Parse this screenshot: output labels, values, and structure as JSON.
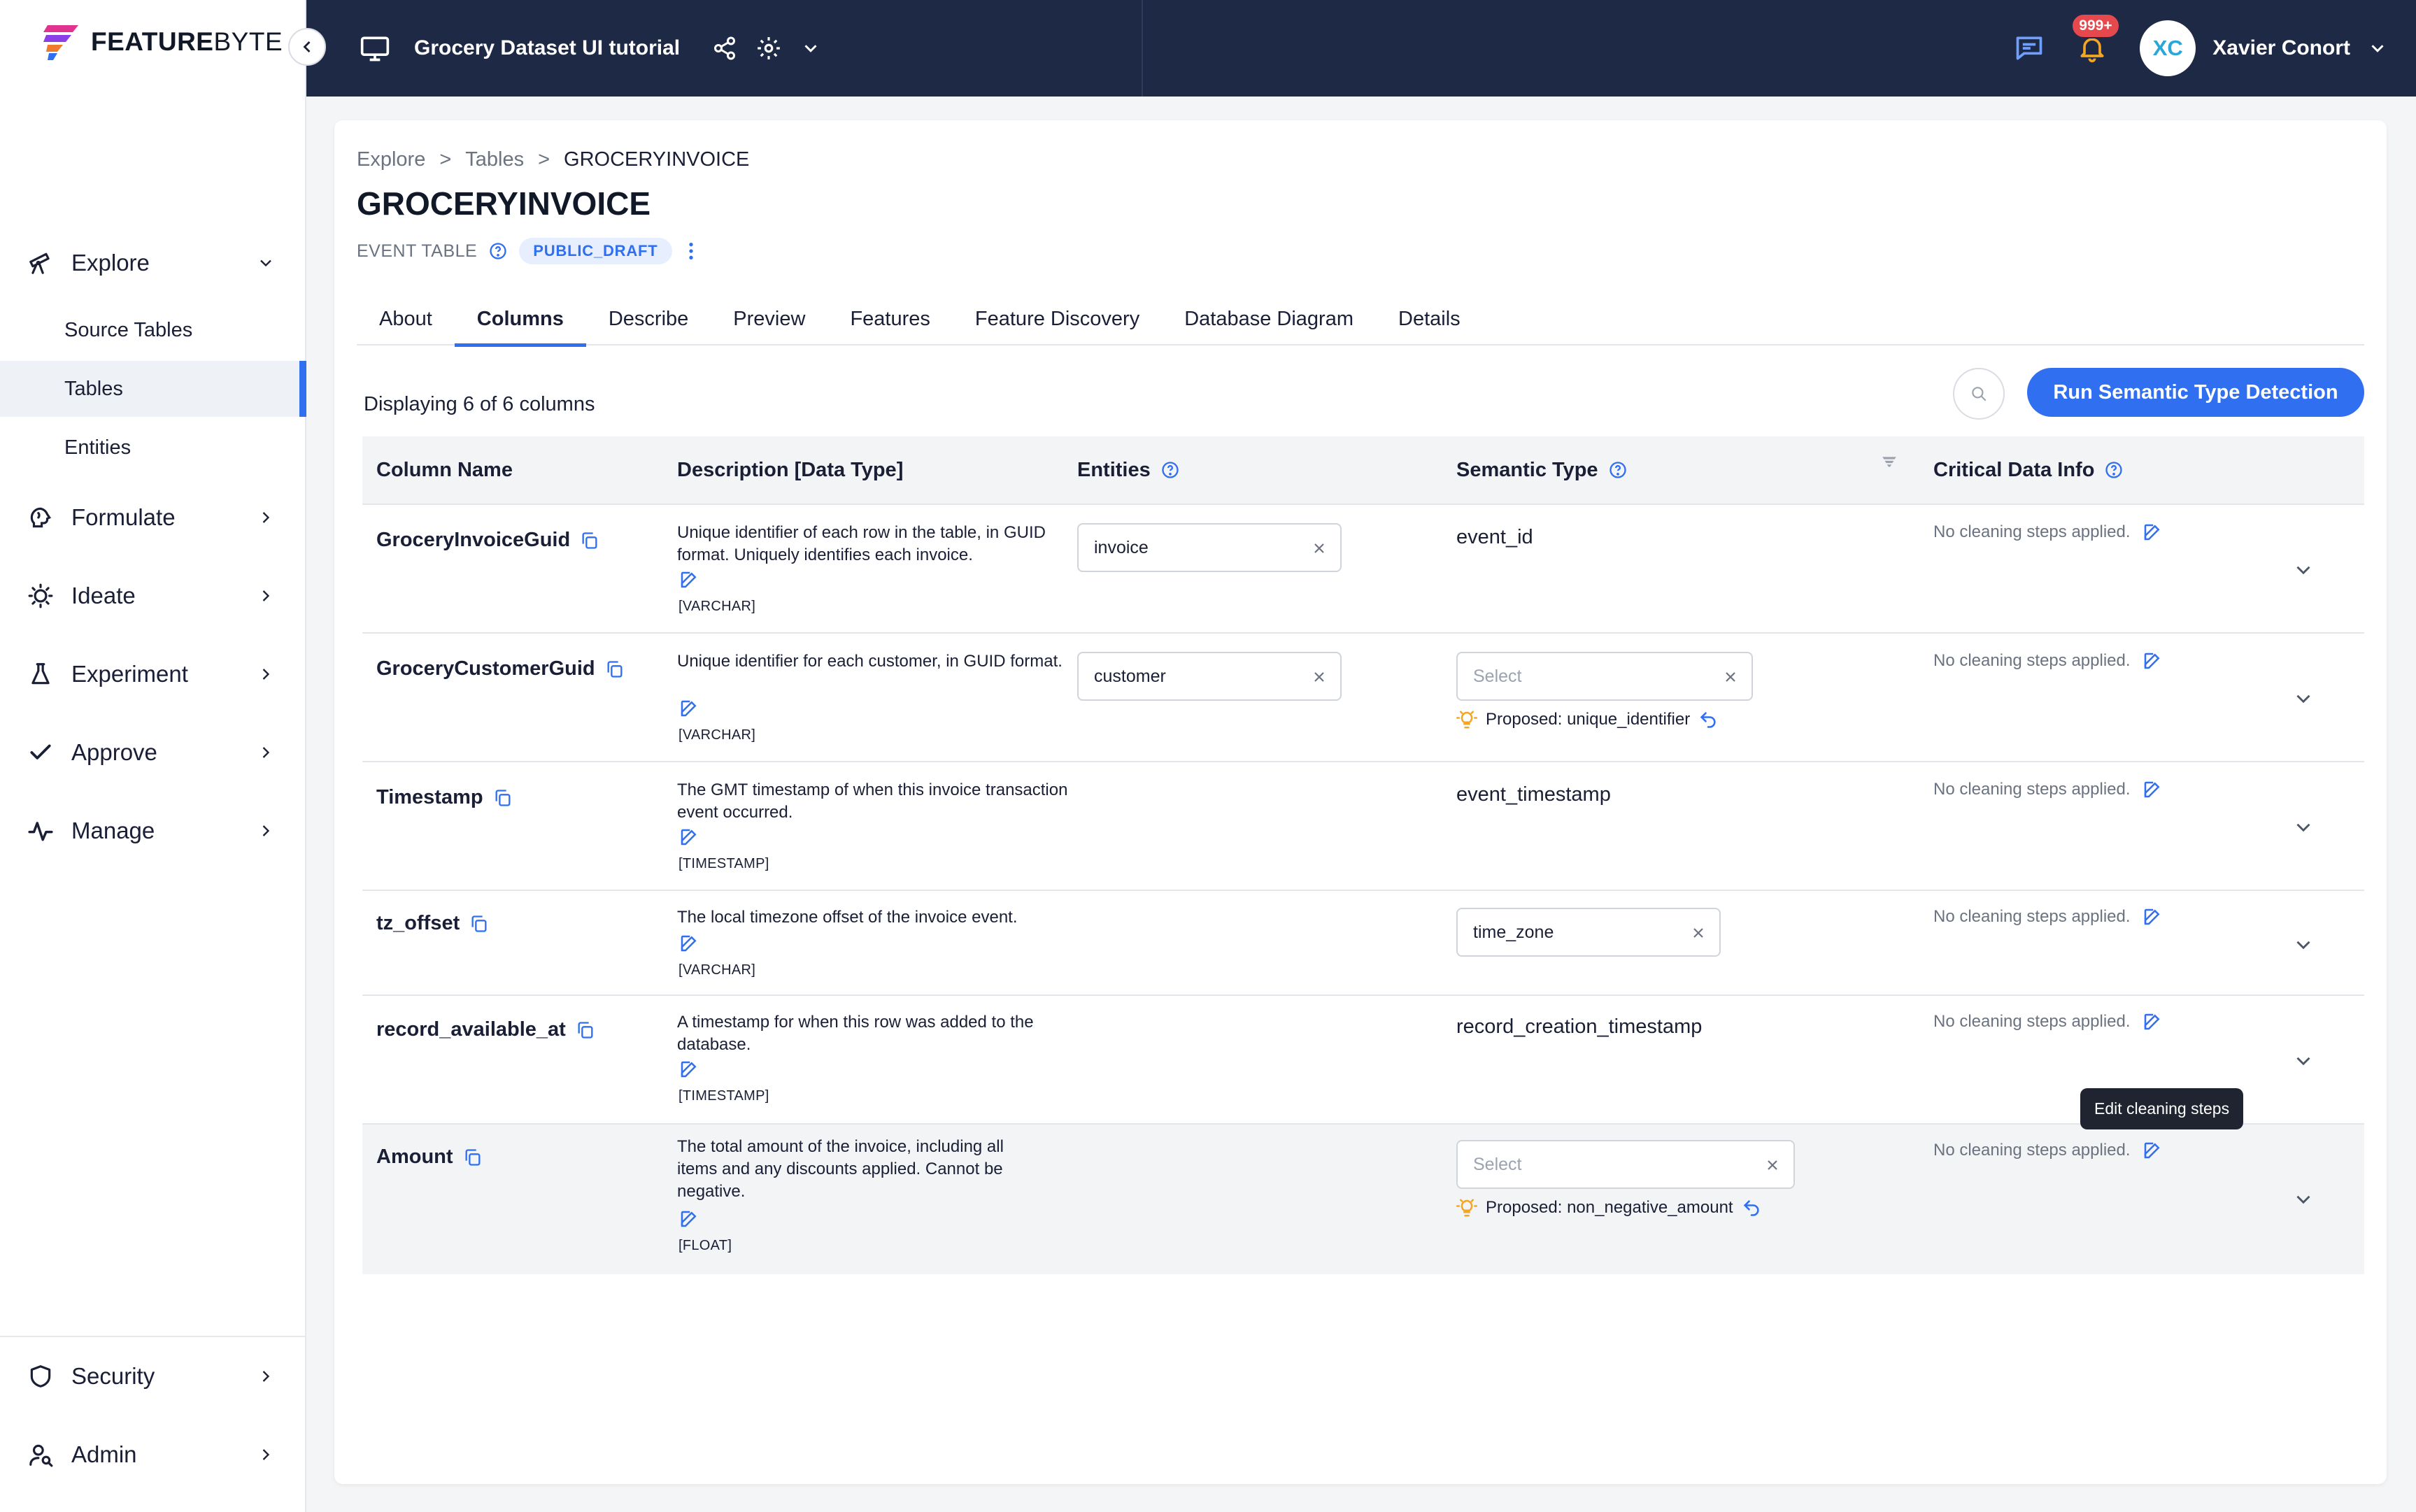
{
  "brand": {
    "name_bold": "FEATURE",
    "name_light": "BYTE"
  },
  "sidebar": {
    "items": [
      {
        "id": "explore",
        "label": "Explore",
        "icon": "telescope-icon",
        "expanded": true
      },
      {
        "id": "formulate",
        "label": "Formulate",
        "icon": "brain-icon"
      },
      {
        "id": "ideate",
        "label": "Ideate",
        "icon": "lightbulb-icon"
      },
      {
        "id": "experiment",
        "label": "Experiment",
        "icon": "flask-icon"
      },
      {
        "id": "approve",
        "label": "Approve",
        "icon": "check-icon"
      },
      {
        "id": "manage",
        "label": "Manage",
        "icon": "pulse-icon"
      },
      {
        "id": "security",
        "label": "Security",
        "icon": "shield-icon"
      },
      {
        "id": "admin",
        "label": "Admin",
        "icon": "user-admin-icon"
      }
    ],
    "explore_sub": [
      {
        "label": "Source Tables"
      },
      {
        "label": "Tables",
        "active": true
      },
      {
        "label": "Entities"
      }
    ]
  },
  "topbar": {
    "project_title": "Grocery Dataset UI tutorial",
    "notification_count": "999+",
    "user_initials": "XC",
    "user_name": "Xavier Conort"
  },
  "breadcrumb": [
    "Explore",
    "Tables",
    "GROCERYINVOICE"
  ],
  "breadcrumb_separator": ">",
  "page": {
    "title": "GROCERYINVOICE",
    "table_type": "EVENT TABLE",
    "status": "PUBLIC_DRAFT"
  },
  "tabs": [
    "About",
    "Columns",
    "Describe",
    "Preview",
    "Features",
    "Feature Discovery",
    "Database Diagram",
    "Details"
  ],
  "active_tab": "Columns",
  "columns_view": {
    "displaying_text": "Displaying 6 of 6 columns",
    "run_button": "Run Semantic Type Detection",
    "headers": {
      "column_name": "Column Name",
      "description": "Description [Data Type]",
      "entities": "Entities",
      "semantic_type": "Semantic Type",
      "critical": "Critical Data Info"
    },
    "rows": [
      {
        "name": "GroceryInvoiceGuid",
        "description": "Unique identifier of each row in the table, in GUID format. Uniquely identifies each invoice.",
        "dtype": "[VARCHAR]",
        "entity": "invoice",
        "semantic": "event_id",
        "semantic_select": null,
        "proposed": null,
        "cleaning": "No cleaning steps applied."
      },
      {
        "name": "GroceryCustomerGuid",
        "description": "Unique identifier for each customer, in GUID format.",
        "dtype": "[VARCHAR]",
        "entity": "customer",
        "semantic": null,
        "semantic_select": "Select",
        "proposed": "Proposed: unique_identifier",
        "cleaning": "No cleaning steps applied."
      },
      {
        "name": "Timestamp",
        "description": "The GMT timestamp of when this invoice transaction event occurred.",
        "dtype": "[TIMESTAMP]",
        "entity": null,
        "semantic": "event_timestamp",
        "semantic_select": null,
        "proposed": null,
        "cleaning": "No cleaning steps applied."
      },
      {
        "name": "tz_offset",
        "description": "The local timezone offset of the invoice event.",
        "dtype": "[VARCHAR]",
        "entity": null,
        "semantic": null,
        "semantic_chip": "time_zone",
        "proposed": null,
        "cleaning": "No cleaning steps applied."
      },
      {
        "name": "record_available_at",
        "description": "A timestamp for when this row was added to the database.",
        "dtype": "[TIMESTAMP]",
        "entity": null,
        "semantic": "record_creation_timestamp",
        "semantic_select": null,
        "proposed": null,
        "cleaning": "No cleaning steps applied."
      },
      {
        "name": "Amount",
        "description": "The total amount of the invoice, including all items and any discounts applied. Cannot be negative.",
        "dtype": "[FLOAT]",
        "entity": null,
        "semantic": null,
        "semantic_select": "Select",
        "proposed": "Proposed: non_negative_amount",
        "cleaning": "No cleaning steps applied."
      }
    ]
  },
  "tooltip": "Edit cleaning steps",
  "colors": {
    "accent": "#2f6ff0",
    "topbar": "#1e2a45",
    "badge": "#e5484d",
    "bulb": "#f5a524"
  }
}
